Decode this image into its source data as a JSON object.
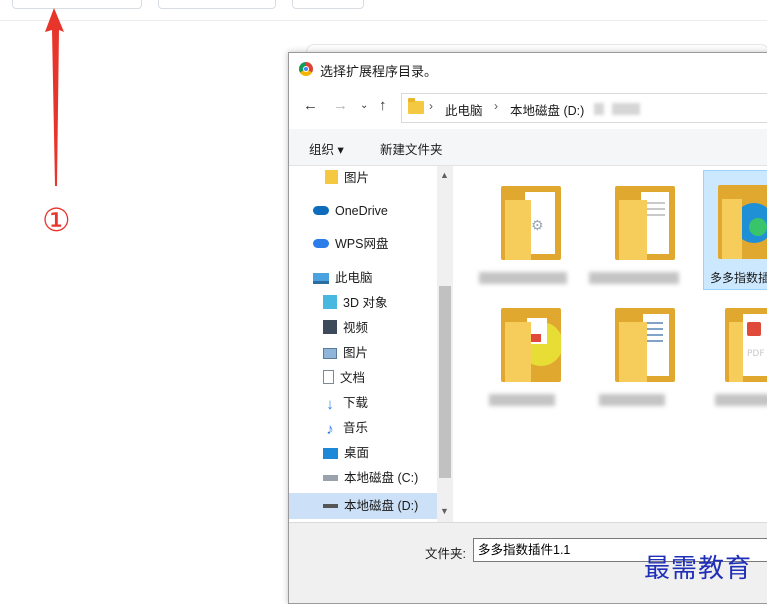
{
  "annotation": {
    "step_marker": "①"
  },
  "dialog": {
    "title": "选择扩展程序目录。",
    "breadcrumb": [
      "此电脑",
      "本地磁盘 (D:)"
    ],
    "toolbar": {
      "organize": "组织 ▾",
      "new_folder": "新建文件夹"
    },
    "nav_items": [
      "图片",
      "OneDrive",
      "WPS网盘",
      "此电脑",
      "3D 对象",
      "视频",
      "图片",
      "文档",
      "下载",
      "音乐",
      "桌面",
      "本地磁盘 (C:)",
      "本地磁盘 (D:)"
    ],
    "selected_folder_name": "多多指数插",
    "folder_label": "文件夹:",
    "folder_value": "多多指数插件1.1"
  },
  "watermark": "最需教育",
  "colors": {
    "annotation_red": "#e8352b",
    "selection_blue": "#cce8ff",
    "folder_yellow": "#f5c842",
    "watermark_blue": "#1f2fb8"
  }
}
